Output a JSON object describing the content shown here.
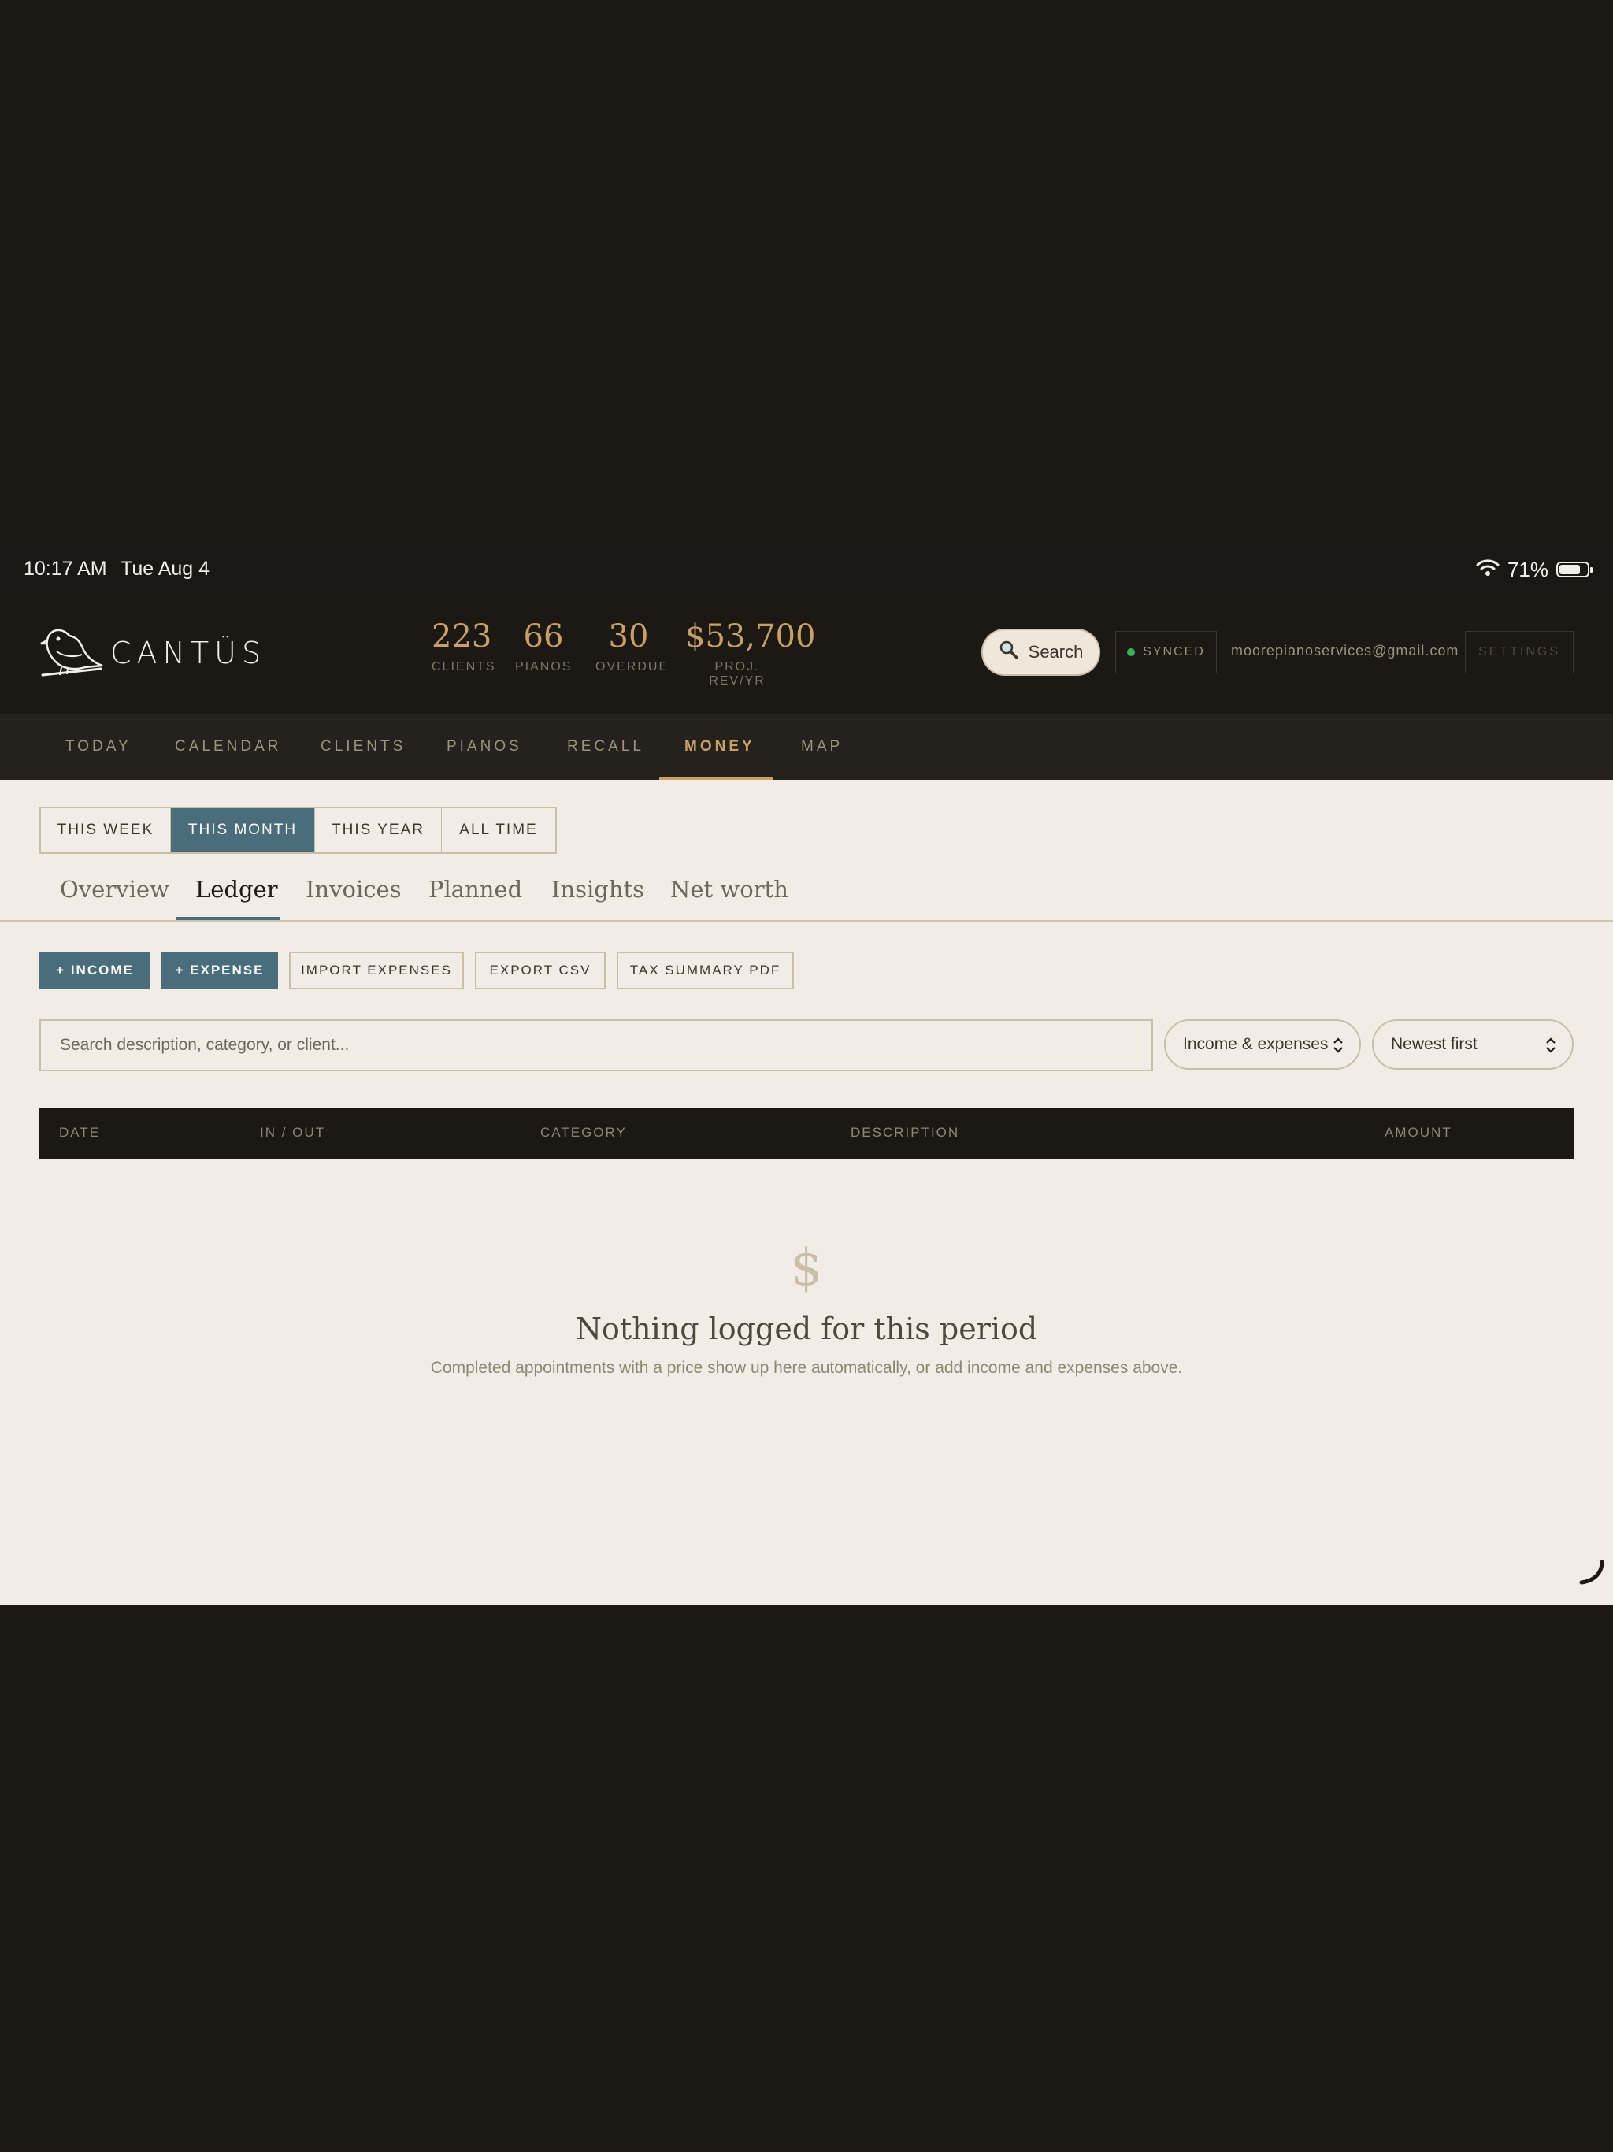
{
  "status_bar": {
    "time": "10:17 AM",
    "date": "Tue Aug 4",
    "battery": "71%",
    "battery_level": 0.71
  },
  "header": {
    "brand": "CANTÜS",
    "stats": [
      {
        "value": "223",
        "label": "CLIENTS"
      },
      {
        "value": "66",
        "label": "PIANOS"
      },
      {
        "value": "30",
        "label": "OVERDUE"
      },
      {
        "value": "$53,700",
        "label": "PROJ. REV/YR"
      }
    ],
    "search_label": "Search",
    "sync_status": "SYNCED",
    "email": "moorepianoservices@gmail.com",
    "settings_label": "SETTINGS"
  },
  "nav": {
    "items": [
      "TODAY",
      "CALENDAR",
      "CLIENTS",
      "PIANOS",
      "RECALL",
      "MONEY",
      "MAP"
    ],
    "active": "MONEY"
  },
  "periods": {
    "items": [
      "THIS WEEK",
      "THIS MONTH",
      "THIS YEAR",
      "ALL TIME"
    ],
    "active": "THIS MONTH"
  },
  "subtabs": {
    "items": [
      "Overview",
      "Ledger",
      "Invoices",
      "Planned",
      "Insights",
      "Net worth"
    ],
    "active": "Ledger"
  },
  "actions": {
    "income": "+ INCOME",
    "expense": "+ EXPENSE",
    "import": "IMPORT EXPENSES",
    "export": "EXPORT CSV",
    "tax": "TAX SUMMARY PDF"
  },
  "filters": {
    "search_placeholder": "Search description, category, or client...",
    "type_value": "Income & expenses",
    "sort_value": "Newest first"
  },
  "table": {
    "columns": [
      "DATE",
      "IN / OUT",
      "CATEGORY",
      "DESCRIPTION",
      "AMOUNT"
    ]
  },
  "empty_state": {
    "icon": "$",
    "title": "Nothing logged for this period",
    "subtitle": "Completed appointments with a price show up here automatically, or add income and expenses above."
  },
  "colors": {
    "accent_gold": "#c7a064",
    "accent_blue": "#4a6d7c",
    "dark": "#1c1915",
    "paper": "#f1ede6",
    "synced": "#2fb45a"
  }
}
